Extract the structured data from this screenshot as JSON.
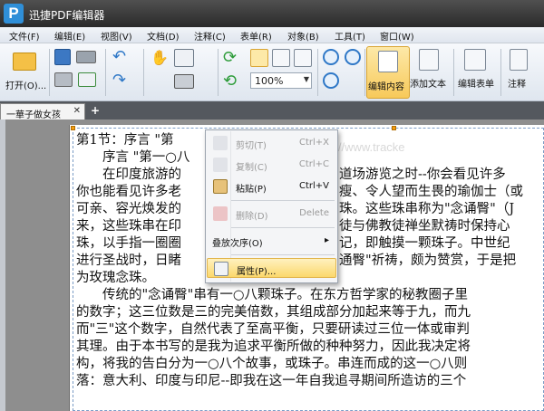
{
  "app": {
    "title": "迅捷PDF编辑器",
    "logo_letter": "P"
  },
  "menu": [
    "文件(F)",
    "编辑(E)",
    "视图(V)",
    "文档(D)",
    "注释(C)",
    "表单(R)",
    "对象(B)",
    "工具(T)",
    "窗口(W)"
  ],
  "toolbar": {
    "open_label": "打开(O)...",
    "zoom_value": "100%",
    "edit_content": "编辑内容",
    "add_text": "添加文本",
    "edit_form": "编辑表单",
    "annotate": "注释"
  },
  "tab": {
    "title": "一華子做女孩",
    "close": "✕",
    "add": "+"
  },
  "document": {
    "watermark": "anada) Ltd. • http://www.tracke",
    "lines": [
      "第1节：序言 \"第",
      "　　序言 \"第一○八",
      "　　在印度旅游的",
      "你也能看见许多老",
      "可亲、容光焕发的",
      "来，这些珠串在印",
      "珠，以手指一圈圈",
      "进行圣战时，日睹",
      "为玫瑰念珠。",
      "　　传统的\"念诵臀\"串有一○八颗珠子。在东方哲学家的秘教圈子里",
      "的数字；这三位数是三的完美倍数，其组成部分加起来等于九，而九",
      "而\"三\"这个数字，自然代表了至高平衡，只要研读过三位一体或审判",
      "其理。由于本书写的是我为追求平衡所做的种种努力，因此我决定将",
      "构，将我的告白分为一○八个故事，或珠子。串连而成的这一○八则",
      "落：意大利、印度与印尼--即我在这一年自我追寻期间所造访的三个"
    ],
    "right_fragments": [
      "道场游览之时--你会看见许多",
      "瘦、令人望而生畏的瑜伽士（或",
      "珠。这些珠串称为\"念诵臀\"（J",
      "徒与佛教徒禅坐默祷时保持心",
      "记，即触摸一颗珠子。中世纪",
      "通臀\"祈祷，颇为赞赏，于是把"
    ]
  },
  "context_menu": {
    "cut": {
      "label": "剪切(T)",
      "shortcut": "Ctrl+X"
    },
    "copy": {
      "label": "复制(C)",
      "shortcut": "Ctrl+C"
    },
    "paste": {
      "label": "粘贴(P)",
      "shortcut": "Ctrl+V"
    },
    "delete": {
      "label": "删除(D)",
      "shortcut": "Delete"
    },
    "order": {
      "label": "叠放次序(O)",
      "arrow": "▸"
    },
    "properties": {
      "label": "属性(P)..."
    }
  },
  "colors": {
    "highlight": "#fbd86c",
    "titlebar": "#2a2a2a",
    "active_button": "#f7c95a",
    "logo": "#2f8fd8"
  }
}
